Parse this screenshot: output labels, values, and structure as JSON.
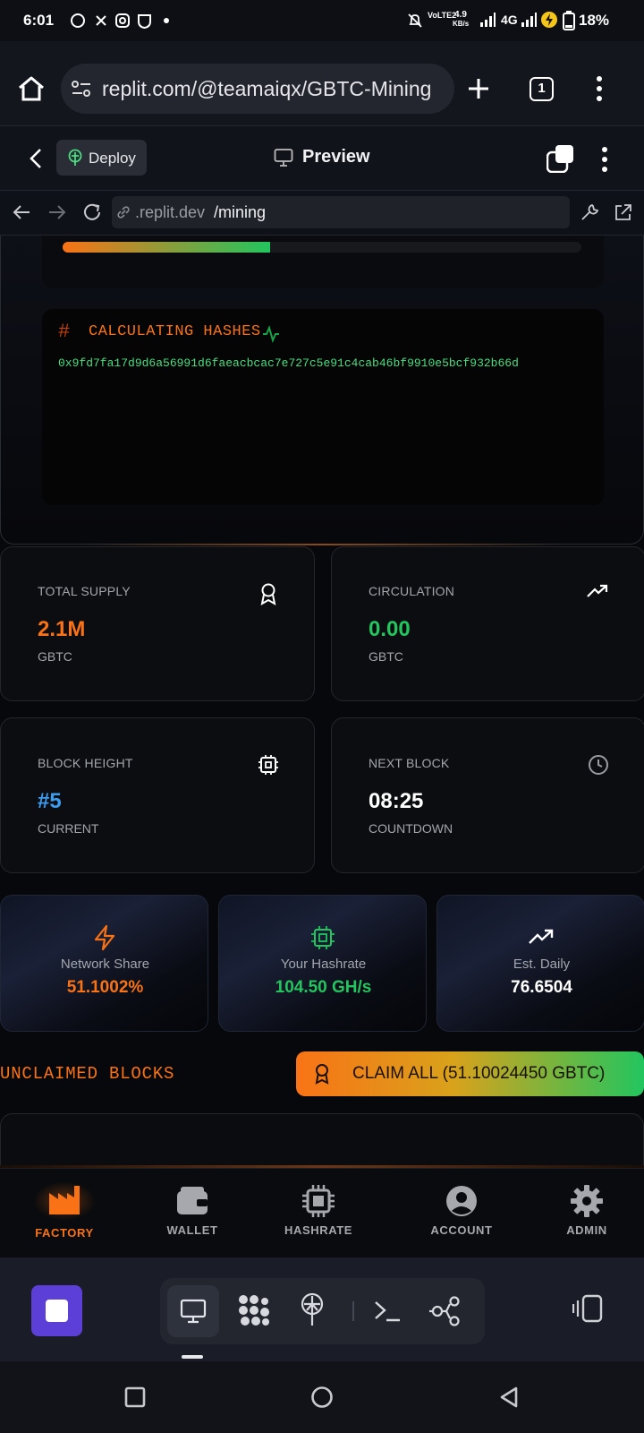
{
  "status_bar": {
    "time": "6:01",
    "net_speed": "4.9",
    "net_unit": "KB/s",
    "volte": "VoLTE2",
    "network": "4G",
    "battery": "18%"
  },
  "browser": {
    "url": "replit.com/@teamaiqx/GBTC-Mining",
    "tab_count": "1"
  },
  "replit": {
    "deploy_label": "Deploy",
    "preview_label": "Preview"
  },
  "addr": {
    "domain": ".replit.dev",
    "path": "/mining"
  },
  "progress": {
    "fraction": 0.4
  },
  "hash_panel": {
    "title": "CALCULATING HASHES",
    "hash": "0x9fd7fa17d9d6a56991d6faeacbcac7e727c5e91c4cab46bf9910e5bcf932b66d"
  },
  "stats": {
    "total_supply": {
      "label": "TOTAL SUPPLY",
      "value": "2.1M",
      "unit": "GBTC"
    },
    "circulation": {
      "label": "CIRCULATION",
      "value": "0.00",
      "unit": "GBTC"
    },
    "block_height": {
      "label": "BLOCK HEIGHT",
      "value": "#5",
      "unit": "CURRENT"
    },
    "next_block": {
      "label": "NEXT BLOCK",
      "value": "08:25",
      "unit": "COUNTDOWN"
    }
  },
  "mini": {
    "network_share": {
      "label": "Network Share",
      "value": "51.1002%"
    },
    "hashrate": {
      "label": "Your Hashrate",
      "value": "104.50 GH/s"
    },
    "daily": {
      "label": "Est. Daily",
      "value": "76.6504"
    }
  },
  "unclaimed": {
    "title": "UNCLAIMED BLOCKS",
    "claim_label": "CLAIM ALL (51.10024450 GBTC)"
  },
  "nav": {
    "factory": "FACTORY",
    "wallet": "WALLET",
    "hashrate": "HASHRATE",
    "account": "ACCOUNT",
    "admin": "ADMIN"
  },
  "colors": {
    "orange": "#f97316",
    "green": "#22c55e",
    "blue": "#3b9cf0",
    "purple": "#5b3fd6"
  }
}
